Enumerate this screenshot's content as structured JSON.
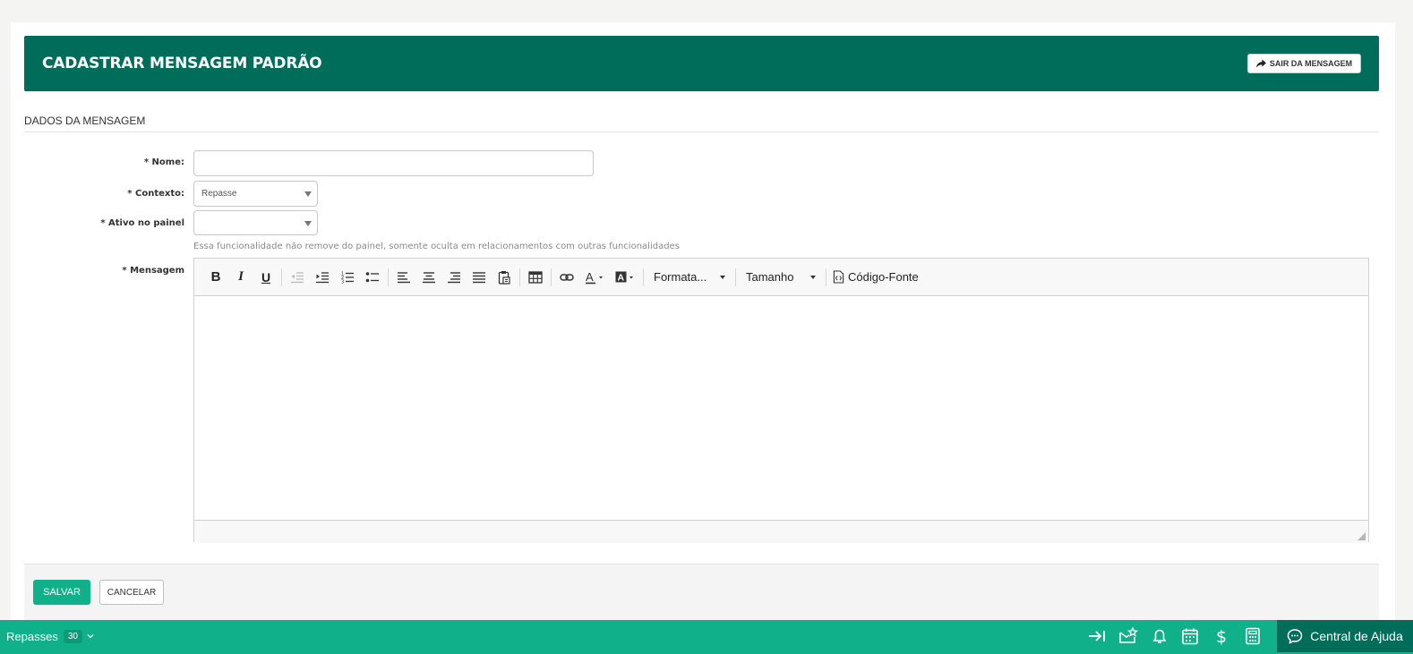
{
  "header": {
    "title": "CADASTRAR MENSAGEM PADRÃO",
    "exit_label": "SAIR DA MENSAGEM"
  },
  "section": {
    "title": "DADOS DA MENSAGEM"
  },
  "form": {
    "name": {
      "label": "* Nome:",
      "value": ""
    },
    "context": {
      "label": "* Contexto:",
      "selected": "Repasse"
    },
    "active": {
      "label": "* Ativo no painel",
      "selected": ""
    },
    "hint": "Essa funcionalidade não remove do painel, somente oculta em relacionamentos com outras funcionalidades",
    "message": {
      "label": "* Mensagem"
    }
  },
  "editor": {
    "bold": "B",
    "italic": "I",
    "underline": "U",
    "format_label": "Formata...",
    "size_label": "Tamanho",
    "source_label": "Código-Fonte"
  },
  "actions": {
    "save": "SALVAR",
    "cancel": "CANCELAR"
  },
  "bottombar": {
    "module": "Repasses",
    "count": "30",
    "help": "Central de Ajuda"
  },
  "colors": {
    "header_bg": "#006d5b",
    "accent": "#0fb08a"
  }
}
